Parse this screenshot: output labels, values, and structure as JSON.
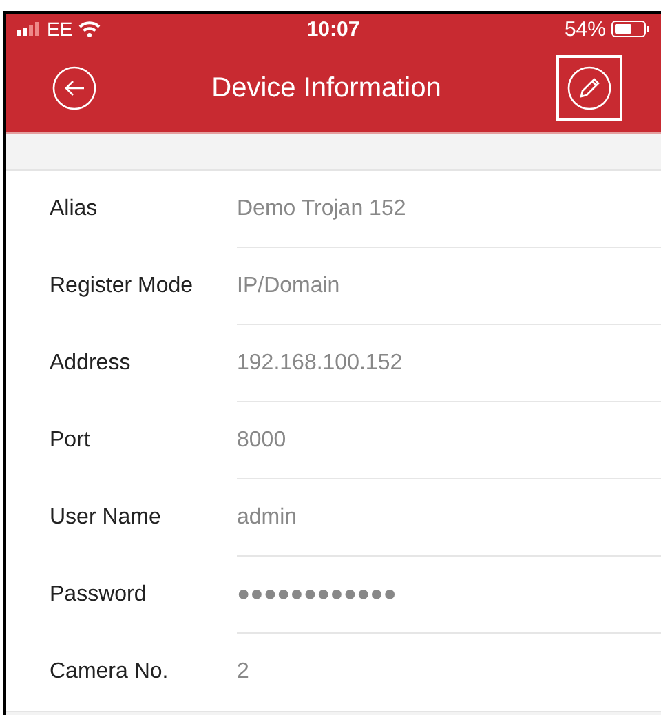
{
  "status_bar": {
    "carrier": "EE",
    "time": "10:07",
    "battery": "54%"
  },
  "nav_bar": {
    "title": "Device Information"
  },
  "fields": [
    {
      "label": "Alias",
      "value": "Demo Trojan 152"
    },
    {
      "label": "Register Mode",
      "value": "IP/Domain"
    },
    {
      "label": "Address",
      "value": "192.168.100.152"
    },
    {
      "label": "Port",
      "value": "8000"
    },
    {
      "label": "User Name",
      "value": "admin"
    },
    {
      "label": "Password",
      "value": "●●●●●●●●●●●●"
    },
    {
      "label": "Camera No.",
      "value": "2"
    }
  ]
}
